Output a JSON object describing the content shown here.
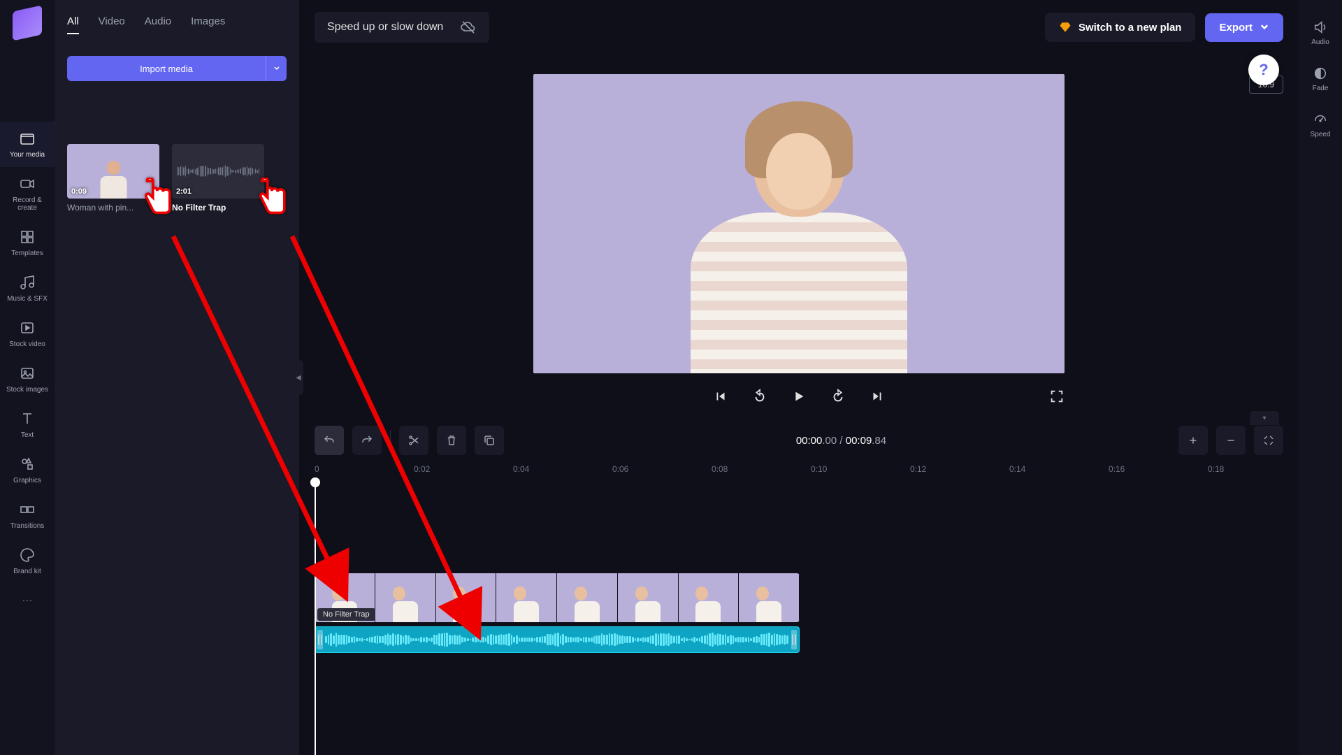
{
  "leftRail": {
    "items": [
      {
        "label": "Your media",
        "icon": "folder"
      },
      {
        "label": "Record & create",
        "icon": "camera"
      },
      {
        "label": "Templates",
        "icon": "grid"
      },
      {
        "label": "Music & SFX",
        "icon": "music"
      },
      {
        "label": "Stock video",
        "icon": "film"
      },
      {
        "label": "Stock images",
        "icon": "image"
      },
      {
        "label": "Text",
        "icon": "text"
      },
      {
        "label": "Graphics",
        "icon": "shapes"
      },
      {
        "label": "Transitions",
        "icon": "transitions"
      },
      {
        "label": "Brand kit",
        "icon": "palette"
      }
    ],
    "more": "…"
  },
  "mediaPanel": {
    "tabs": [
      "All",
      "Video",
      "Audio",
      "Images"
    ],
    "activeTab": "All",
    "importLabel": "Import media",
    "items": [
      {
        "title": "Woman with pin...",
        "duration": "0:09",
        "type": "video"
      },
      {
        "title": "No Filter Trap",
        "duration": "2:01",
        "type": "audio"
      }
    ]
  },
  "topbar": {
    "projectTitle": "Speed up or slow down",
    "planLabel": "Switch to a new plan",
    "exportLabel": "Export"
  },
  "preview": {
    "aspect": "16:9"
  },
  "timeline": {
    "currentTime": "00:00",
    "currentMs": ".00",
    "totalTime": "00:09",
    "totalMs": ".84",
    "sep": " / ",
    "ticks": [
      "0",
      "0:02",
      "0:04",
      "0:06",
      "0:08",
      "0:10",
      "0:12",
      "0:14",
      "0:16",
      "0:18"
    ],
    "audioClipLabel": "No Filter Trap"
  },
  "rightRail": {
    "items": [
      {
        "label": "Audio",
        "icon": "speaker"
      },
      {
        "label": "Fade",
        "icon": "fade"
      },
      {
        "label": "Speed",
        "icon": "speed"
      }
    ]
  },
  "help": "?"
}
